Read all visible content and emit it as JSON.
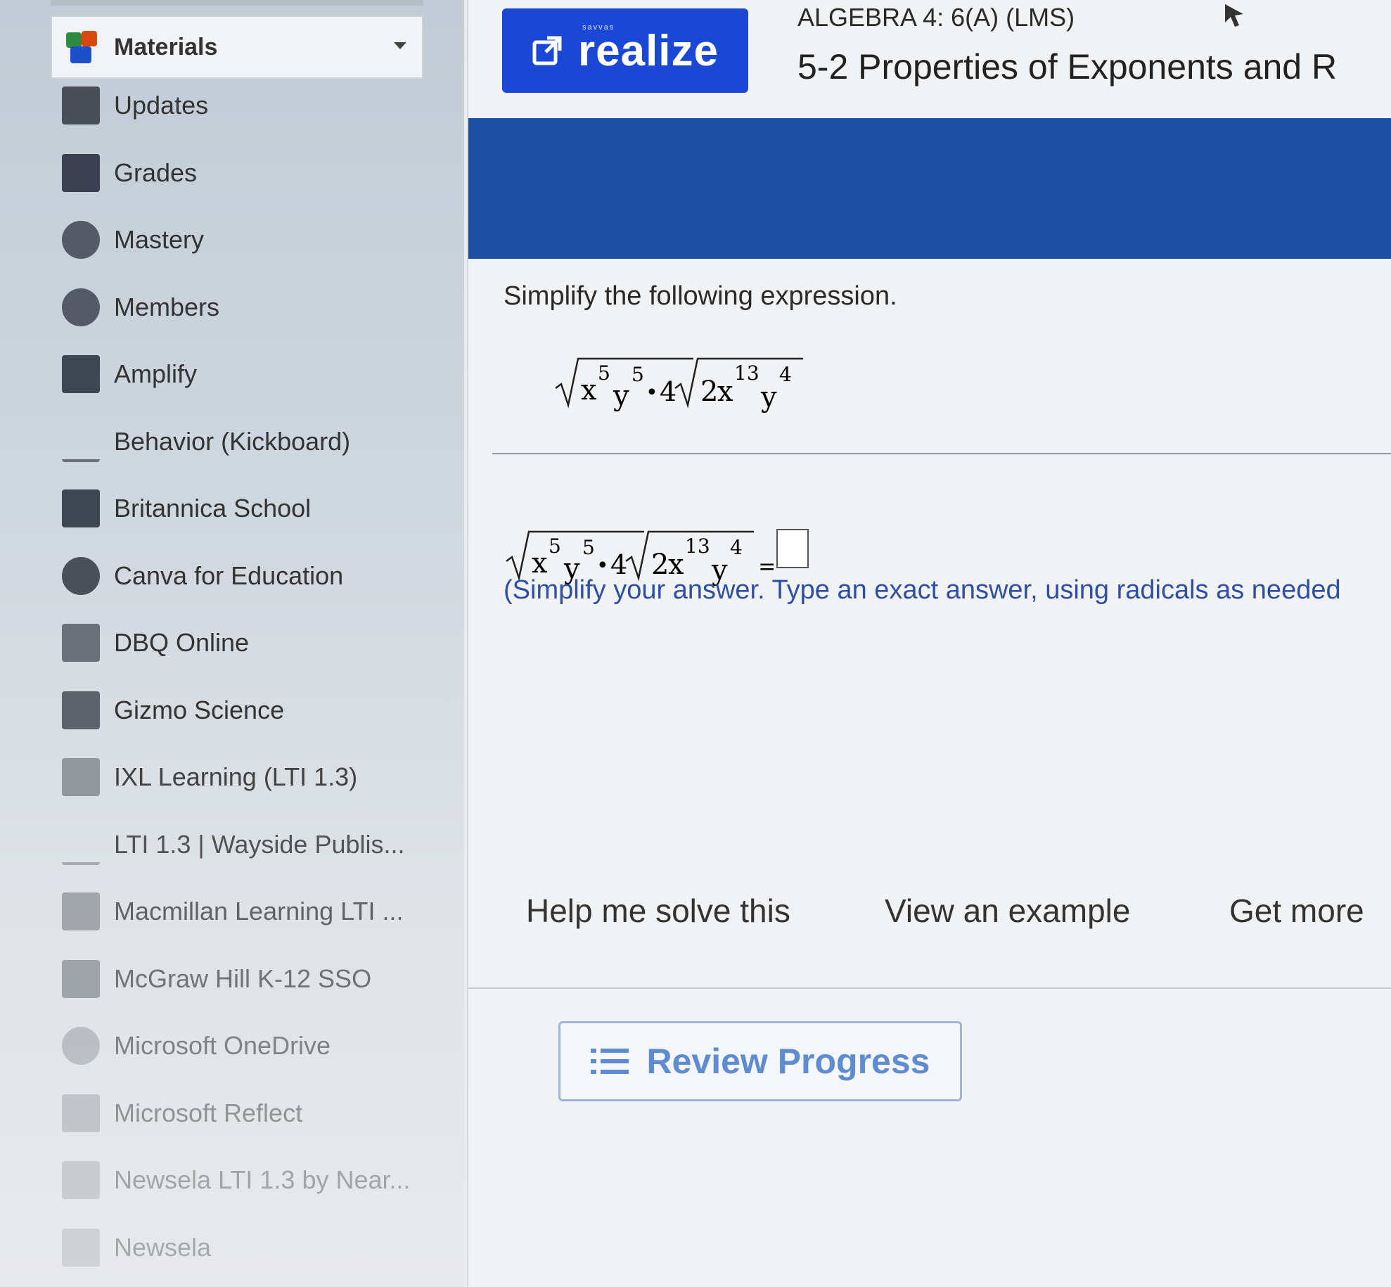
{
  "sidebar": {
    "materials_label": "Materials",
    "items": [
      {
        "label": "Updates",
        "icon": "updates-icon",
        "color": "#4a4f57"
      },
      {
        "label": "Grades",
        "icon": "bar-chart-icon",
        "color": "#3b4150"
      },
      {
        "label": "Mastery",
        "icon": "mastery-gauge-icon",
        "color": "#555b66"
      },
      {
        "label": "Members",
        "icon": "person-icon",
        "color": "#555b66"
      },
      {
        "label": "Amplify",
        "icon": "amplify-a-icon",
        "color": "#3e4652"
      },
      {
        "label": "Behavior (Kickboard)",
        "icon": "kickboard-icon",
        "color": "#6b717a"
      },
      {
        "label": "Britannica School",
        "icon": "britannica-icon",
        "color": "#3e4652"
      },
      {
        "label": "Canva for Education",
        "icon": "canva-icon",
        "color": "#4a505a"
      },
      {
        "label": "DBQ Online",
        "icon": "dbq-icon",
        "color": "#6b717a"
      },
      {
        "label": "Gizmo Science",
        "icon": "gizmo-icon",
        "color": "#5c636d"
      },
      {
        "label": "IXL Learning (LTI 1.3)",
        "icon": "ixl-icon",
        "color": "#8a8f96"
      },
      {
        "label": "LTI 1.3 | Wayside Publis...",
        "icon": "wayside-icon",
        "color": "#9aa0a6"
      },
      {
        "label": "Macmillan Learning LTI ...",
        "icon": "macmillan-icon",
        "color": "#8a8f96"
      },
      {
        "label": "McGraw Hill K-12 SSO",
        "icon": "mcgraw-icon",
        "color": "#7a8088"
      },
      {
        "label": "Microsoft OneDrive",
        "icon": "cloud-icon",
        "color": "#9aa0a6"
      },
      {
        "label": "Microsoft Reflect",
        "icon": "reflect-icon",
        "color": "#9aa0a6"
      },
      {
        "label": "Newsela LTI 1.3 by Near...",
        "icon": "newsela-icon",
        "color": "#9aa0a6"
      },
      {
        "label": "Newsela",
        "icon": "newsela-box-icon",
        "color": "#a4a9ae"
      }
    ]
  },
  "header": {
    "realize_label": "realize",
    "realize_sublabel": "savvas",
    "course": "ALGEBRA 4: 6(A) (LMS)",
    "lesson": "5-2 Properties of Exponents and R"
  },
  "question": {
    "prompt": "Simplify the following expression.",
    "instructions": "(Simplify your answer. Type an exact answer, using radicals as needed",
    "expression": {
      "coef": "4",
      "dot": "•",
      "equals": "=",
      "r1": {
        "x": "x",
        "xexp": "5",
        "y": "y",
        "yexp": "5"
      },
      "r2": {
        "c": "2",
        "x": "x",
        "xexp": "13",
        "y": "y",
        "yexp": "4"
      }
    }
  },
  "help": {
    "solve": "Help me solve this",
    "example": "View an example",
    "more": "Get more"
  },
  "review_label": "Review Progress",
  "colors": {
    "brand": "#1a47d6",
    "banner": "#1d4ea1",
    "instruction_text": "#2f4fa3",
    "review_accent": "#5f8bd1"
  }
}
